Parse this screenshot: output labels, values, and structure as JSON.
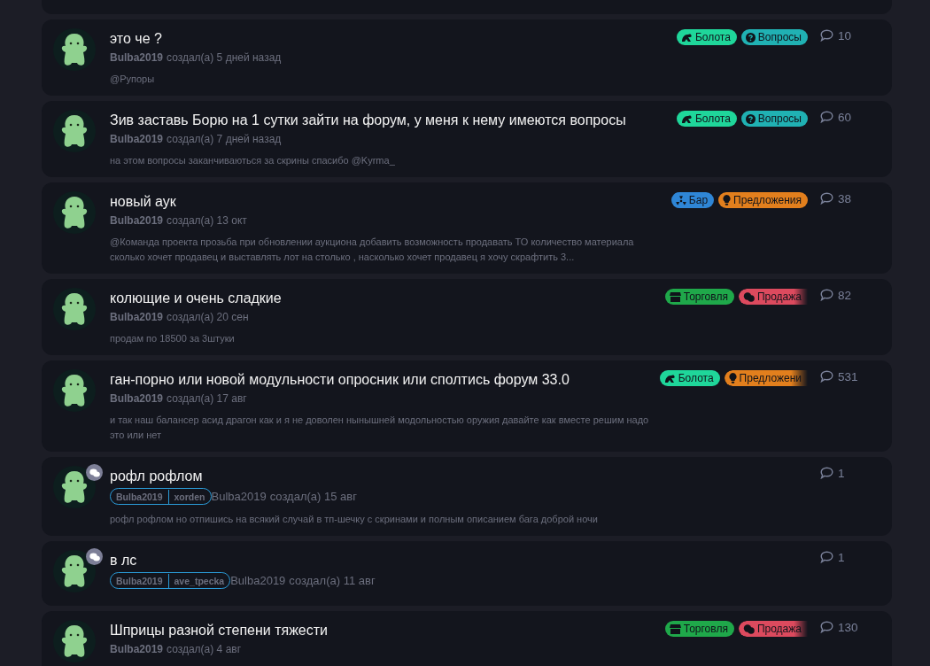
{
  "topics": [
    {
      "title": "это че ?",
      "author": "Bulba2019",
      "created": "создал(а) 5 дней назад",
      "excerpt": "@Рупоры",
      "private": false,
      "tags": [
        {
          "label": "Болота",
          "kind": "swamp",
          "color": "#1fd69a",
          "faded": false
        },
        {
          "label": "Вопросы",
          "kind": "question",
          "color": "#20b1b3",
          "faded": false
        }
      ],
      "replies": "10"
    },
    {
      "title": "Зив заставь Борю на 1 сутки зайти на форум, у меня к нему имеются вопросы",
      "author": "Bulba2019",
      "created": "создал(а) 7 дней назад",
      "excerpt": "на этом вопросы заканчиваються за скрины спасибо @Kyrma_",
      "private": false,
      "tags": [
        {
          "label": "Болота",
          "kind": "swamp",
          "color": "#1fd69a",
          "faded": false
        },
        {
          "label": "Вопросы",
          "kind": "question",
          "color": "#20b1b3",
          "faded": false
        }
      ],
      "replies": "60"
    },
    {
      "title": "новый аук",
      "author": "Bulba2019",
      "created": "создал(а) 13 окт",
      "excerpt": "@Команда проекта прозьба при обновлении аукциона добавить возможность продавать ТО количество материала сколько хочет продавец и выставлять лот на столько , насколько хочет продавец я хочу скрафтить 3...",
      "private": false,
      "tags": [
        {
          "label": "Бар",
          "kind": "radiation",
          "color": "#2f86d6",
          "faded": false
        },
        {
          "label": "Предложения",
          "kind": "bulb",
          "color": "#e27f1d",
          "faded": false
        }
      ],
      "replies": "38"
    },
    {
      "title": "колющие и очень сладкие",
      "author": "Bulba2019",
      "created": "создал(а) 20 сен",
      "excerpt": "продам по 18500 за 3штуки",
      "private": false,
      "tags": [
        {
          "label": "Торговля",
          "kind": "shop",
          "color": "#1fa84a",
          "faded": false
        },
        {
          "label": "Продажа",
          "kind": "money",
          "color": "#dc4a5e",
          "faded": true
        }
      ],
      "replies": "82"
    },
    {
      "title": "ган-порно или новой модульности опросник или сполтись форум 33.0",
      "author": "Bulba2019",
      "created": "создал(а) 17 авг",
      "excerpt": "и так наш балансер асид драгон как и я не доволен нынышней модольностью оружия давайте как вместе решим надо это или нет",
      "private": false,
      "tags": [
        {
          "label": "Болота",
          "kind": "swamp",
          "color": "#1fd69a",
          "faded": false
        },
        {
          "label": "Предложени",
          "kind": "bulb",
          "color": "#e27f1d",
          "faded": true
        }
      ],
      "replies": "531"
    },
    {
      "title": "рофл рофлом",
      "participants": [
        "Bulba2019",
        "xorden"
      ],
      "author": "Bulba2019",
      "created": "создал(а) 15 авг",
      "excerpt": "рофл рофлом но отпишись на всякий случай в тп-шечку с скринами и полным описанием бага доброй ночи",
      "private": true,
      "replies": "1"
    },
    {
      "title": "в лс",
      "participants": [
        "Bulba2019",
        "ave_tpecka"
      ],
      "author": "Bulba2019",
      "created": "создал(а) 11 авг",
      "private": true,
      "replies": "1"
    },
    {
      "title": "Шприцы разной степени тяжести",
      "author": "Bulba2019",
      "created": "создал(а) 4 авг",
      "private": false,
      "tags": [
        {
          "label": "Торговля",
          "kind": "shop",
          "color": "#1fa84a",
          "faded": false
        },
        {
          "label": "Продажа",
          "kind": "money",
          "color": "#dc4a5e",
          "faded": true
        }
      ],
      "replies": "130"
    }
  ]
}
